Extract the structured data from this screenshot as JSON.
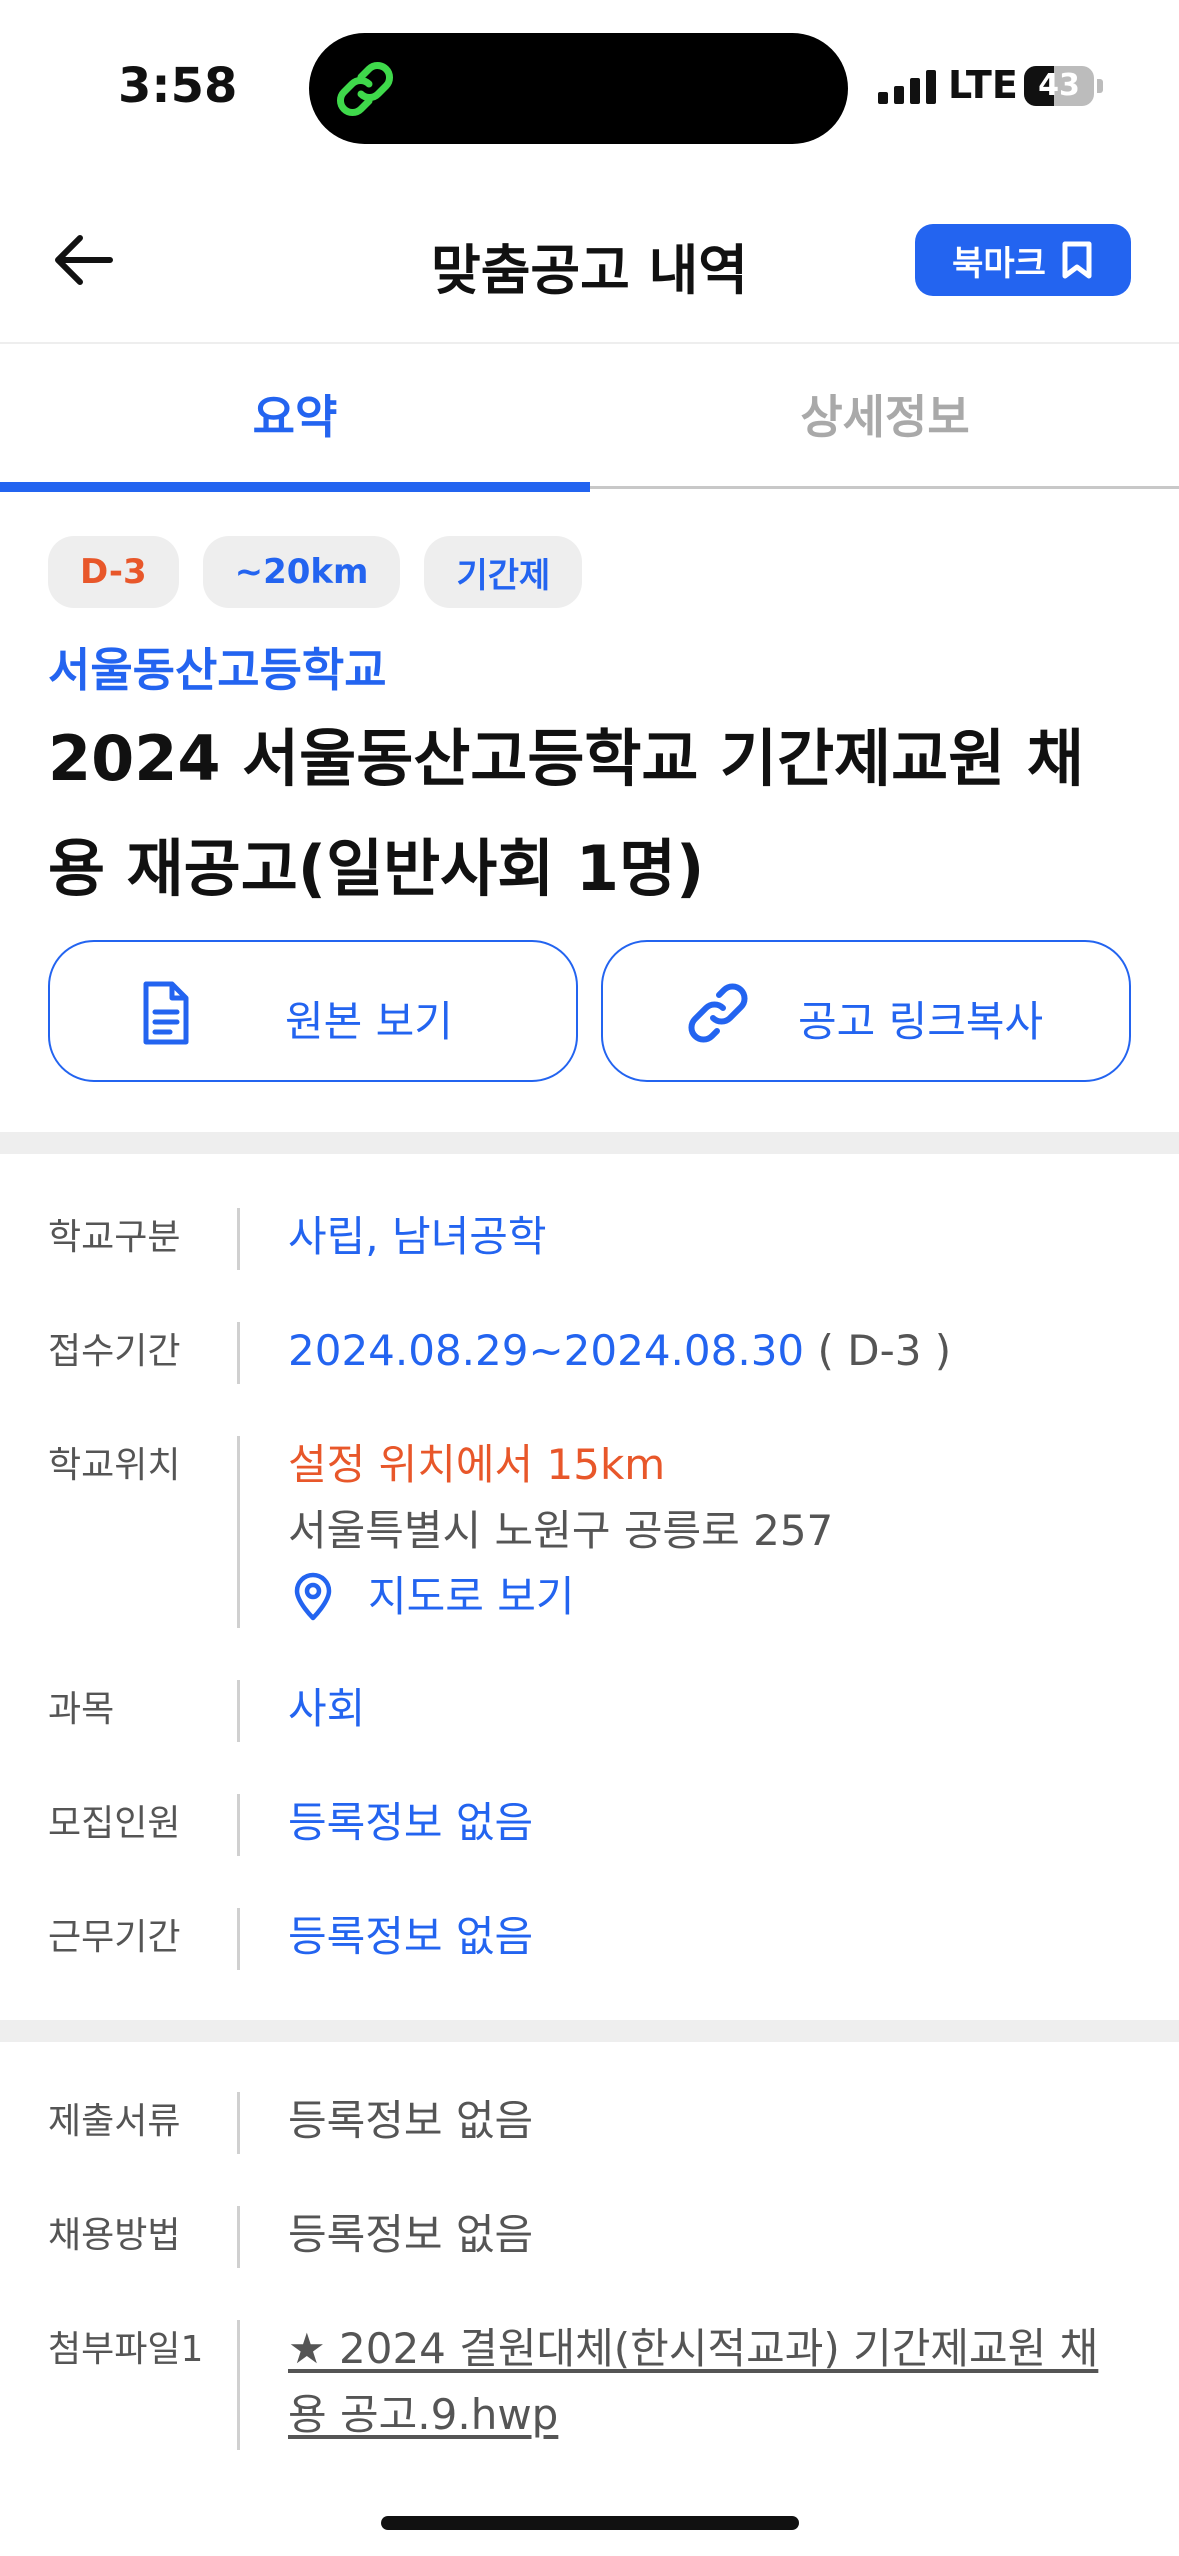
{
  "status_bar": {
    "time": "3:58",
    "network": "LTE",
    "battery_level": "43",
    "battery_fraction": 0.43,
    "island_icon": "link-app-icon"
  },
  "header": {
    "title": "맞춤공고 내역",
    "back_icon": "arrow-left-icon",
    "bookmark_label": "북마크",
    "bookmark_icon": "bookmark-icon"
  },
  "tabs": [
    {
      "label": "요약",
      "active": true
    },
    {
      "label": "상세정보",
      "active": false
    }
  ],
  "chips": [
    "D-3",
    "~20km",
    "기간제"
  ],
  "posting": {
    "school_name": "서울동산고등학교",
    "title": "2024 서울동산고등학교 기간제교원 채용 재공고(일반사회 1명)"
  },
  "actions": {
    "view_original": "원본 보기",
    "copy_link": "공고 링크복사"
  },
  "info_section_1": {
    "school_type": {
      "label": "학교구분",
      "value": "사립, 남녀공학"
    },
    "application_period": {
      "label": "접수기간",
      "value": "2024.08.29~2024.08.30",
      "dday": " ( D-3 )"
    },
    "location": {
      "label": "학교위치",
      "distance": "설정 위치에서 15km",
      "address": "서울특별시 노원구 공릉로 257",
      "map_link": "지도로 보기"
    },
    "subject": {
      "label": "과목",
      "value": "사회"
    },
    "recruit_count": {
      "label": "모집인원",
      "value": "등록정보 없음"
    },
    "work_period": {
      "label": "근무기간",
      "value": "등록정보 없음"
    }
  },
  "info_section_2": {
    "documents": {
      "label": "제출서류",
      "value": "등록정보 없음"
    },
    "hiring_method": {
      "label": "채용방법",
      "value": "등록정보 없음"
    },
    "attachment": {
      "label": "첨부파일1",
      "value": "★ 2024 결원대체(한시적교과) 기간제교원 채용 공고.9.hwp"
    }
  },
  "colors": {
    "accent": "#2364f0",
    "dday": "#e8572a",
    "chip_bg": "#eeeeee"
  }
}
